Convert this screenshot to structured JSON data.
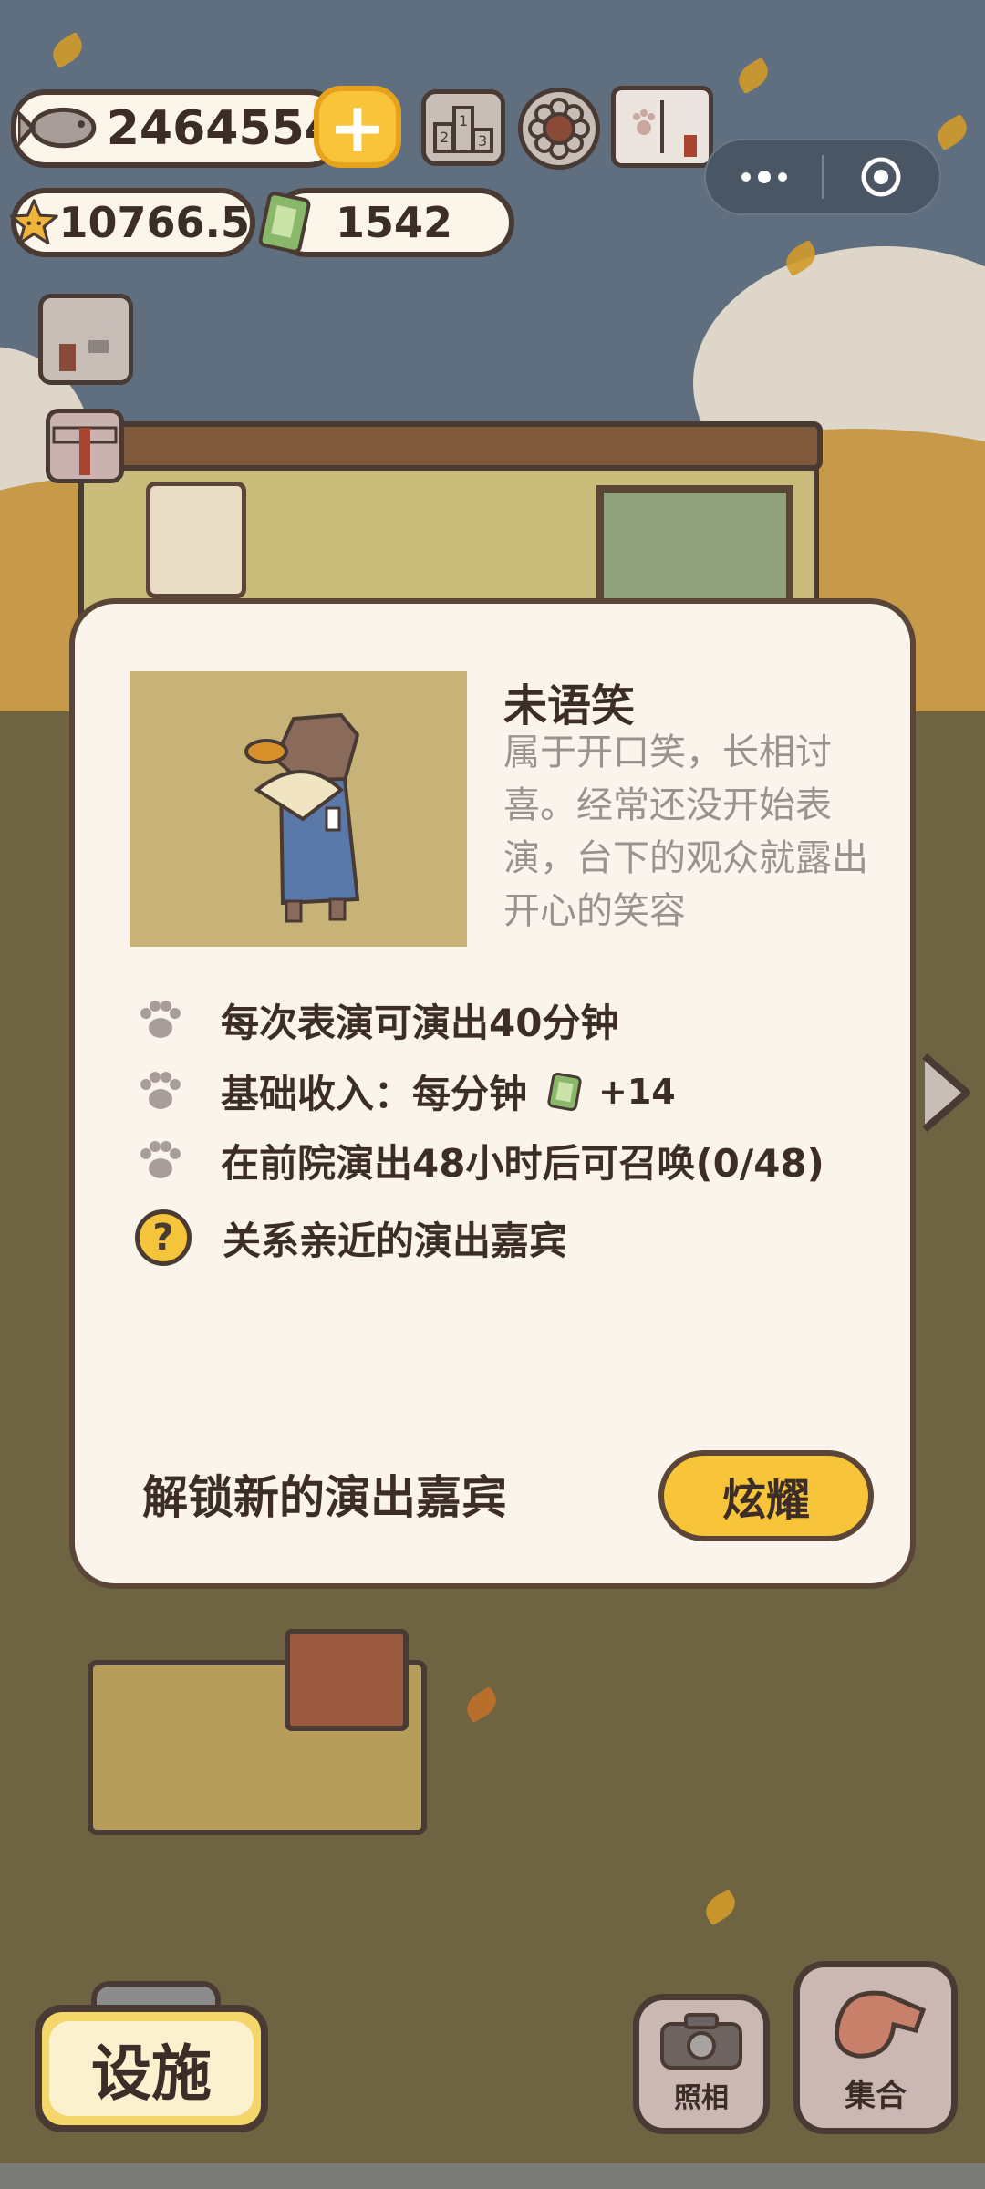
{
  "hud": {
    "fish_count": "2464554",
    "star_count": "10766.5",
    "ticket_count": "1542",
    "icons": [
      "fish-icon",
      "plus-icon",
      "ranking-icon",
      "settings-gear-icon",
      "guide-book-icon",
      "star-icon",
      "ticket-icon"
    ]
  },
  "system_capsule": {
    "icons": [
      "more-dots-icon",
      "close-target-icon"
    ]
  },
  "dialog": {
    "name": "未语笑",
    "description": "属于开口笑，长相讨喜。经常还没开始表演，台下的观众就露出开心的笑容",
    "row1": "每次表演可演出40分钟",
    "row2_prefix": "基础收入：每分钟",
    "row2_value": "+14",
    "row3": "在前院演出48小时后可召唤(0/48)",
    "row4": "关系亲近的演出嘉宾",
    "unlock_text": "解锁新的演出嘉宾",
    "show_button": "炫耀"
  },
  "bottom": {
    "facility_button": "设施",
    "photo_button": "照相",
    "gather_button": "集合"
  },
  "colors": {
    "dialog_bg": "#fbf4ec",
    "accent_yellow": "#f7c43a",
    "text_dark": "#3d2d28",
    "text_muted": "#9b918d"
  }
}
